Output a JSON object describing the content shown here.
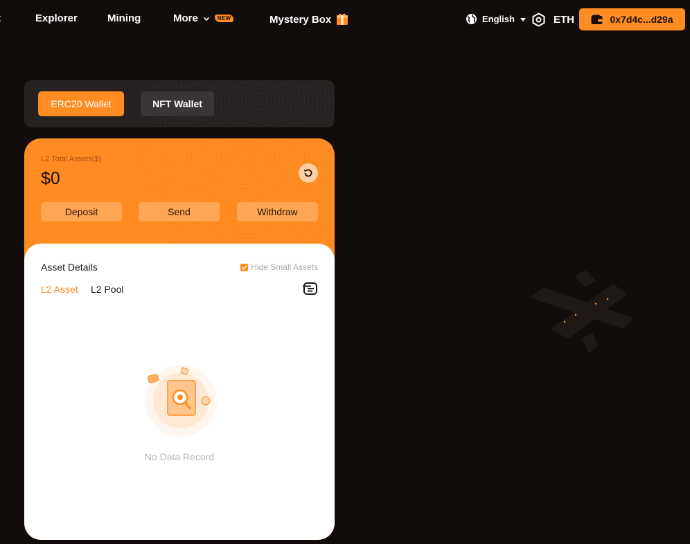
{
  "nav": {
    "cut_label": "t",
    "explorer": "Explorer",
    "mining": "Mining",
    "more": "More",
    "new_badge": "NEW",
    "mystery_box": "Mystery Box",
    "language": "English",
    "network": "ETH",
    "wallet_address": "0x7d4c...d29a"
  },
  "wallet_tabs": {
    "erc20": "ERC20 Wallet",
    "nft": "NFT Wallet"
  },
  "assets": {
    "total_label": "L2 Total Assets($)",
    "total_value": "$0",
    "deposit": "Deposit",
    "send": "Send",
    "withdraw": "Withdraw"
  },
  "details": {
    "title": "Asset Details",
    "hide_small": "Hide Small Assets",
    "hide_small_checked": true,
    "tabs": [
      "L2 Asset",
      "L2 Pool"
    ],
    "active_tab": "L2 Asset",
    "empty_text": "No Data Record"
  },
  "colors": {
    "accent": "#ff8c23",
    "background": "#120c0b"
  },
  "icons": {
    "language": "globe-icon",
    "network": "hexagon-icon",
    "wallet": "wallet-icon",
    "mystery_box": "gift-box-icon",
    "refresh": "refresh-icon",
    "list": "list-icon"
  }
}
